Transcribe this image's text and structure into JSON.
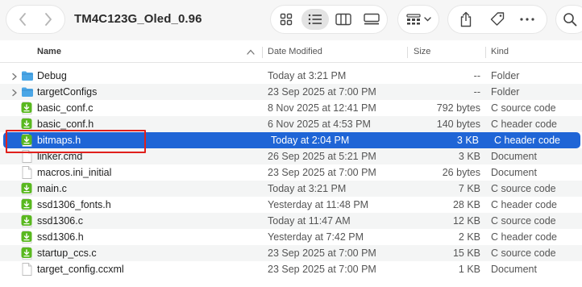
{
  "window": {
    "title": "TM4C123G_Oled_0.96"
  },
  "toolbar": {
    "icons": {
      "back": "chevron-left-icon",
      "forward": "chevron-right-icon",
      "icon_view": "grid-icon",
      "list_view": "list-icon",
      "column_view": "columns-icon",
      "gallery_view": "gallery-icon",
      "group": "group-icon",
      "share": "share-icon",
      "tag": "tag-icon",
      "more": "more-icon",
      "search": "search-icon"
    }
  },
  "columns": {
    "name": "Name",
    "date": "Date Modified",
    "size": "Size",
    "kind": "Kind"
  },
  "colors": {
    "selection": "#1f65d6",
    "folder": "#4aa6e6",
    "source_badge": "#59b81f",
    "highlight_box": "#e0201c"
  },
  "files": [
    {
      "name": "Debug",
      "date": "Today at 3:21 PM",
      "size": "--",
      "kind": "Folder",
      "type": "folder",
      "expandable": true
    },
    {
      "name": "targetConfigs",
      "date": "23 Sep 2025 at 7:00 PM",
      "size": "--",
      "kind": "Folder",
      "type": "folder",
      "expandable": true
    },
    {
      "name": "basic_conf.c",
      "date": "8 Nov 2025 at 12:41 PM",
      "size": "792 bytes",
      "kind": "C source code",
      "type": "c"
    },
    {
      "name": "basic_conf.h",
      "date": "6 Nov 2025 at 4:53 PM",
      "size": "140 bytes",
      "kind": "C header code",
      "type": "h"
    },
    {
      "name": "bitmaps.h",
      "date": "Today at 2:04 PM",
      "size": "3 KB",
      "kind": "C header code",
      "type": "h",
      "selected": true
    },
    {
      "name": "linker.cmd",
      "date": "26 Sep 2025 at 5:21 PM",
      "size": "3 KB",
      "kind": "Document",
      "type": "doc"
    },
    {
      "name": "macros.ini_initial",
      "date": "23 Sep 2025 at 7:00 PM",
      "size": "26 bytes",
      "kind": "Document",
      "type": "doc"
    },
    {
      "name": "main.c",
      "date": "Today at 3:21 PM",
      "size": "7 KB",
      "kind": "C source code",
      "type": "c"
    },
    {
      "name": "ssd1306_fonts.h",
      "date": "Yesterday at 11:48 PM",
      "size": "28 KB",
      "kind": "C header code",
      "type": "h"
    },
    {
      "name": "ssd1306.c",
      "date": "Today at 11:47 AM",
      "size": "12 KB",
      "kind": "C source code",
      "type": "c"
    },
    {
      "name": "ssd1306.h",
      "date": "Yesterday at 7:42 PM",
      "size": "2 KB",
      "kind": "C header code",
      "type": "h"
    },
    {
      "name": "startup_ccs.c",
      "date": "23 Sep 2025 at 7:00 PM",
      "size": "15 KB",
      "kind": "C source code",
      "type": "c"
    },
    {
      "name": "target_config.ccxml",
      "date": "23 Sep 2025 at 7:00 PM",
      "size": "1 KB",
      "kind": "Document",
      "type": "doc"
    }
  ]
}
